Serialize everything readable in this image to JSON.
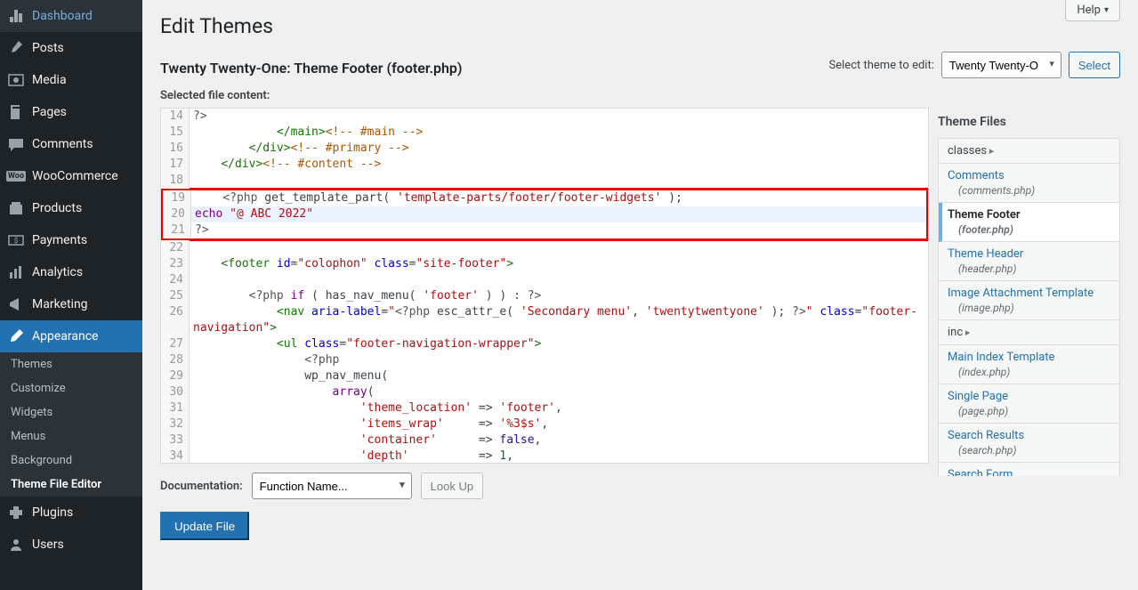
{
  "sidebar": {
    "items": [
      {
        "icon": "dashboard",
        "label": "Dashboard"
      },
      {
        "icon": "pin",
        "label": "Posts"
      },
      {
        "icon": "media",
        "label": "Media"
      },
      {
        "icon": "page",
        "label": "Pages"
      },
      {
        "icon": "comment",
        "label": "Comments"
      },
      {
        "icon": "woo",
        "label": "WooCommerce"
      },
      {
        "icon": "product",
        "label": "Products"
      },
      {
        "icon": "payment",
        "label": "Payments"
      },
      {
        "icon": "analytics",
        "label": "Analytics"
      },
      {
        "icon": "marketing",
        "label": "Marketing"
      },
      {
        "icon": "appearance",
        "label": "Appearance",
        "current": true
      },
      {
        "icon": "plugin",
        "label": "Plugins"
      },
      {
        "icon": "users",
        "label": "Users"
      }
    ],
    "submenu": [
      {
        "label": "Themes"
      },
      {
        "label": "Customize"
      },
      {
        "label": "Widgets"
      },
      {
        "label": "Menus"
      },
      {
        "label": "Background"
      },
      {
        "label": "Theme File Editor",
        "current": true
      }
    ]
  },
  "help_label": "Help",
  "page_title": "Edit Themes",
  "file_description": "Twenty Twenty-One: Theme Footer (footer.php)",
  "select_theme_label": "Select theme to edit:",
  "select_theme_value": "Twenty Twenty-O",
  "select_button": "Select",
  "selected_file_label": "Selected file content:",
  "theme_files_heading": "Theme Files",
  "theme_files": [
    {
      "label": "classes",
      "folder": true
    },
    {
      "label": "Comments",
      "sub": "(comments.php)"
    },
    {
      "label": "Theme Footer",
      "sub": "(footer.php)",
      "current": true
    },
    {
      "label": "Theme Header",
      "sub": "(header.php)"
    },
    {
      "label": "Image Attachment Template",
      "sub": "(image.php)"
    },
    {
      "label": "inc",
      "folder": true
    },
    {
      "label": "Main Index Template",
      "sub": "(index.php)"
    },
    {
      "label": "Single Page",
      "sub": "(page.php)"
    },
    {
      "label": "Search Results",
      "sub": "(search.php)"
    },
    {
      "label": "Search Form"
    }
  ],
  "documentation_label": "Documentation:",
  "function_name_placeholder": "Function Name...",
  "lookup_button": "Look Up",
  "update_button": "Update File",
  "code": {
    "l14": "?>",
    "l15_pre": "            ",
    "l15_tag": "</main>",
    "l15_com": "<!-- #main -->",
    "l16_pre": "        ",
    "l16_tag": "</div>",
    "l16_com": "<!-- #primary -->",
    "l17_pre": "    ",
    "l17_tag": "</div>",
    "l17_com": "<!-- #content -->",
    "l19_pre": "    ",
    "l19_open": "<?php",
    "l19_fn": " get_template_part( ",
    "l19_str": "'template-parts/footer/footer-widgets'",
    "l19_end": " );",
    "l20_kw": "echo ",
    "l20_str": "\"@ ABC 2022\"",
    "l21": "?>",
    "l23_pre": "    ",
    "l23_tag_open": "<footer",
    "l23_attr1": " id",
    "l23_eq": "=",
    "l23_val1": "\"colophon\"",
    "l23_attr2": " class",
    "l23_val2": "\"site-footer\"",
    "l23_close": ">",
    "l25_pre": "        ",
    "l25_open": "<?php",
    "l25_if": " if",
    "l25_cond": " ( has_nav_menu( ",
    "l25_str": "'footer'",
    "l25_end": " ) ) : ",
    "l25_close": "?>",
    "l26_pre": "            ",
    "l26_tag": "<nav",
    "l26_attr": " aria-label",
    "l26_eq": "=",
    "l26_valopen": "\"",
    "l26_php": "<?php",
    "l26_fn": " esc_attr_e( ",
    "l26_s1": "'Secondary menu'",
    "l26_s2": "'twentytwentyone'",
    "l26_fnend": " ); ",
    "l26_phpend": "?>",
    "l26_valclose": "\"",
    "l26_attr2": " class",
    "l26_val2": "\"footer-",
    "l26b": "navigation\"",
    "l26b_close": ">",
    "l27_pre": "            ",
    "l27_tag": "<ul",
    "l27_attr": " class",
    "l27_val": "\"footer-navigation-wrapper\"",
    "l27_close": ">",
    "l28_pre": "                ",
    "l28_php": "<?php",
    "l29_pre": "                ",
    "l29": "wp_nav_menu(",
    "l30_pre": "                    ",
    "l30_kw": "array",
    "l30_p": "(",
    "l31_pre": "                        ",
    "l31_key": "'theme_location'",
    "l31_arrow": " => ",
    "l31_val": "'footer'",
    "l31_c": ",",
    "l32_pre": "                        ",
    "l32_key": "'items_wrap'",
    "l32_sp": "     => ",
    "l32_val": "'%3$s'",
    "l32_c": ",",
    "l33_pre": "                        ",
    "l33_key": "'container'",
    "l33_sp": "      => ",
    "l33_val": "false",
    "l33_c": ",",
    "l34_pre": "                        ",
    "l34_key": "'depth'",
    "l34_sp": "          => ",
    "l34_val": "1",
    "l34_c": ","
  }
}
